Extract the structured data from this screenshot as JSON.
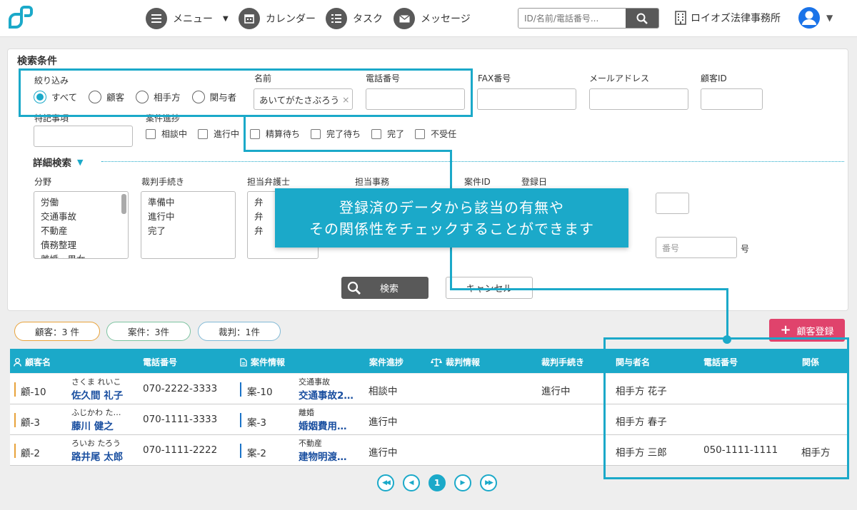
{
  "header": {
    "nav": {
      "menu": "メニュー",
      "calendar": "カレンダー",
      "task": "タスク",
      "message": "メッセージ"
    },
    "search_placeholder": "ID/名前/電話番号...",
    "office_name": "ロイオズ法律事務所"
  },
  "search": {
    "title": "検索条件",
    "filter_label": "絞り込み",
    "filter_options": [
      "すべて",
      "顧客",
      "相手方",
      "関与者"
    ],
    "name_label": "名前",
    "name_value": "あいてがたさぶろう",
    "phone_label": "電話番号",
    "fax_label": "FAX番号",
    "email_label": "メールアドレス",
    "customer_id_label": "顧客ID",
    "notes_label": "特記事項",
    "case_status_label": "案件進捗",
    "status_options": [
      "相談中",
      "進行中",
      "精算待ち",
      "完了待ち",
      "完了",
      "不受任"
    ],
    "detail_label": "詳細検索",
    "field_label": "分野",
    "field_items": [
      "労働",
      "交通事故",
      "不動産",
      "債務整理",
      "離婚・男女"
    ],
    "procedure_label": "裁判手続き",
    "procedure_items": [
      "準備中",
      "進行中",
      "完了"
    ],
    "lawyer_label": "担当弁護士",
    "lawyer_items": [
      "弁",
      "弁",
      "弁"
    ],
    "staff_label": "担当事務",
    "case_id_label": "案件ID",
    "reg_date_label": "登録日",
    "number_placeholder": "番号",
    "number_suffix": "号",
    "search_button": "検索",
    "cancel_button": "キャンセル"
  },
  "callout": {
    "line1": "登録済のデータから該当の有無や",
    "line2": "その関係性をチェックすることができます"
  },
  "counts": {
    "customers": "顧客：3 件",
    "cases": "案件：3件",
    "trials": "裁判：1件"
  },
  "register_button": "顧客登録",
  "table": {
    "headers": {
      "customer": "顧客名",
      "phone": "電話番号",
      "case": "案件情報",
      "progress": "案件進捗",
      "trial": "裁判情報",
      "procedure": "裁判手続き",
      "related": "関与者名",
      "related_phone": "電話番号",
      "relation": "関係"
    },
    "rows": [
      {
        "id": "顧-10",
        "kana": "さくま れいこ",
        "name": "佐久間 礼子",
        "phone": "070-2222-3333",
        "case_id": "案-10",
        "case_type": "交通事故",
        "case_name": "交通事故2…",
        "progress": "相談中",
        "procedure": "進行中",
        "related": "相手方 花子",
        "related_phone": "",
        "relation": ""
      },
      {
        "id": "顧-3",
        "kana": "ふじかわ た…",
        "name": "藤川 健之",
        "phone": "070-1111-3333",
        "case_id": "案-3",
        "case_type": "離婚",
        "case_name": "婚姻費用…",
        "progress": "進行中",
        "procedure": "",
        "related": "相手方 春子",
        "related_phone": "",
        "relation": ""
      },
      {
        "id": "顧-2",
        "kana": "ろいお たろう",
        "name": "路井尾 太郎",
        "phone": "070-1111-2222",
        "case_id": "案-2",
        "case_type": "不動産",
        "case_name": "建物明渡…",
        "progress": "進行中",
        "procedure": "",
        "related": "相手方 三郎",
        "related_phone": "050-1111-1111",
        "relation": "相手方"
      }
    ]
  },
  "pagination": {
    "current": "1"
  },
  "colors": {
    "accent": "#1ba9c9",
    "dark": "#595959",
    "register": "#e0436c",
    "customer_bar": "#e8a23a",
    "case_bar": "#1a73c8"
  }
}
